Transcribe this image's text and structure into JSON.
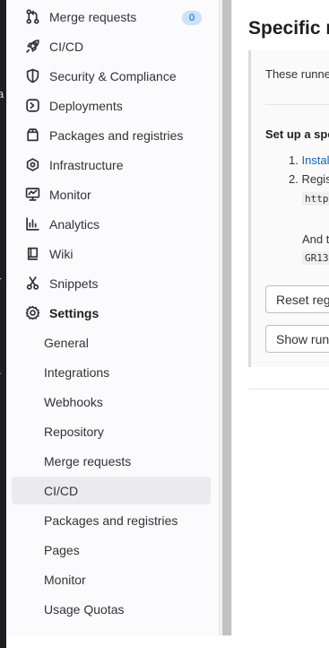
{
  "left_edge_fragments": [
    "a",
    "r",
    "\\"
  ],
  "sidebar": {
    "items": [
      {
        "label": "Merge requests",
        "icon": "merge-request-icon",
        "badge": "0"
      },
      {
        "label": "CI/CD",
        "icon": "rocket-icon"
      },
      {
        "label": "Security & Compliance",
        "icon": "shield-icon"
      },
      {
        "label": "Deployments",
        "icon": "deployments-icon"
      },
      {
        "label": "Packages and registries",
        "icon": "package-icon"
      },
      {
        "label": "Infrastructure",
        "icon": "infrastructure-icon"
      },
      {
        "label": "Monitor",
        "icon": "monitor-icon"
      },
      {
        "label": "Analytics",
        "icon": "analytics-icon"
      },
      {
        "label": "Wiki",
        "icon": "book-icon"
      },
      {
        "label": "Snippets",
        "icon": "scissors-icon"
      },
      {
        "label": "Settings",
        "icon": "gear-icon"
      }
    ],
    "settings_sub": [
      {
        "label": "General"
      },
      {
        "label": "Integrations"
      },
      {
        "label": "Webhooks"
      },
      {
        "label": "Repository"
      },
      {
        "label": "Merge requests"
      },
      {
        "label": "CI/CD",
        "active": true
      },
      {
        "label": "Packages and registries"
      },
      {
        "label": "Pages"
      },
      {
        "label": "Monitor"
      },
      {
        "label": "Usage Quotas"
      }
    ]
  },
  "main": {
    "title": "Specific ru",
    "intro": "These runne",
    "setup_heading": "Set up a spe",
    "step1_num": "1.",
    "step1_link": "Instal",
    "step2": "2. Regis",
    "url_code": "http",
    "and_text": "And t",
    "token_code": "GR13",
    "reset_button": "Reset regi",
    "show_button": "Show run"
  }
}
